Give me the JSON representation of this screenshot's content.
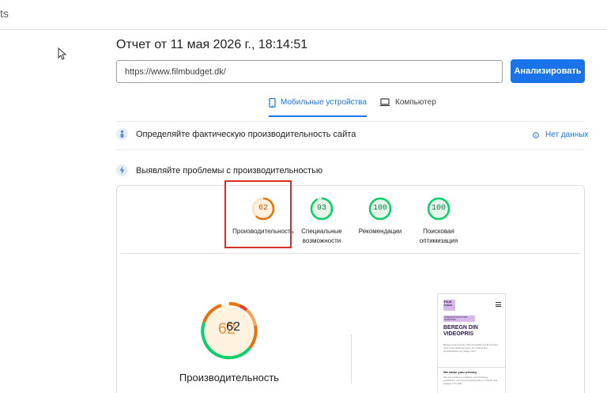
{
  "topbar": {
    "fragment": "ts"
  },
  "report": {
    "title": "Отчет от 11 мая 2026 г., 18:14:51"
  },
  "search": {
    "value": "https://www.filmbudget.dk/",
    "button_label": "Анализировать"
  },
  "tabs": [
    {
      "label": "Мобильные устройства",
      "icon": "smartphone-icon",
      "active": true
    },
    {
      "label": "Компьютер",
      "icon": "laptop-icon",
      "active": false
    }
  ],
  "field_data": {
    "title": "Определяйте фактическую производительность сайта",
    "status": "Нет данных"
  },
  "lab": {
    "title": "Выявляйте проблемы с производительностью"
  },
  "scores": [
    {
      "value": "62",
      "label_line1": "Производительность",
      "label_line2": "",
      "color": "#e8710a",
      "bg": "#fff3e0"
    },
    {
      "value": "93",
      "label_line1": "Специальные",
      "label_line2": "возможности",
      "color": "#0cce6b",
      "bg": "#e6f4ea"
    },
    {
      "value": "100",
      "label_line1": "Рекомендации",
      "label_line2": "",
      "color": "#0cce6b",
      "bg": "#e6f4ea"
    },
    {
      "value": "100",
      "label_line1": "Поисковая",
      "label_line2": "оптимизация",
      "color": "#0cce6b",
      "bg": "#e6f4ea"
    }
  ],
  "big_score": {
    "value": "62",
    "overlay": "62",
    "label": "Производительность",
    "fraction": 0.62
  },
  "preview": {
    "logo_line1": "FILM",
    "logo_line2": "BUDGET",
    "tag": "VIDEOPRODUKTION DANMARK",
    "headline_line1": "BEREGN DIN",
    "headline_line2": "VIDEOPRIS",
    "body": "Beregn prisen på din videoproduktion på få minutter med vores gratis beregner for reklamefilm, produktvideoer og meget mere.",
    "cookie_title": "We value your privacy",
    "cookie_text": "We use cookies to enhance your browsing experience, serve personalised ads or content, and analyse our traffic."
  }
}
